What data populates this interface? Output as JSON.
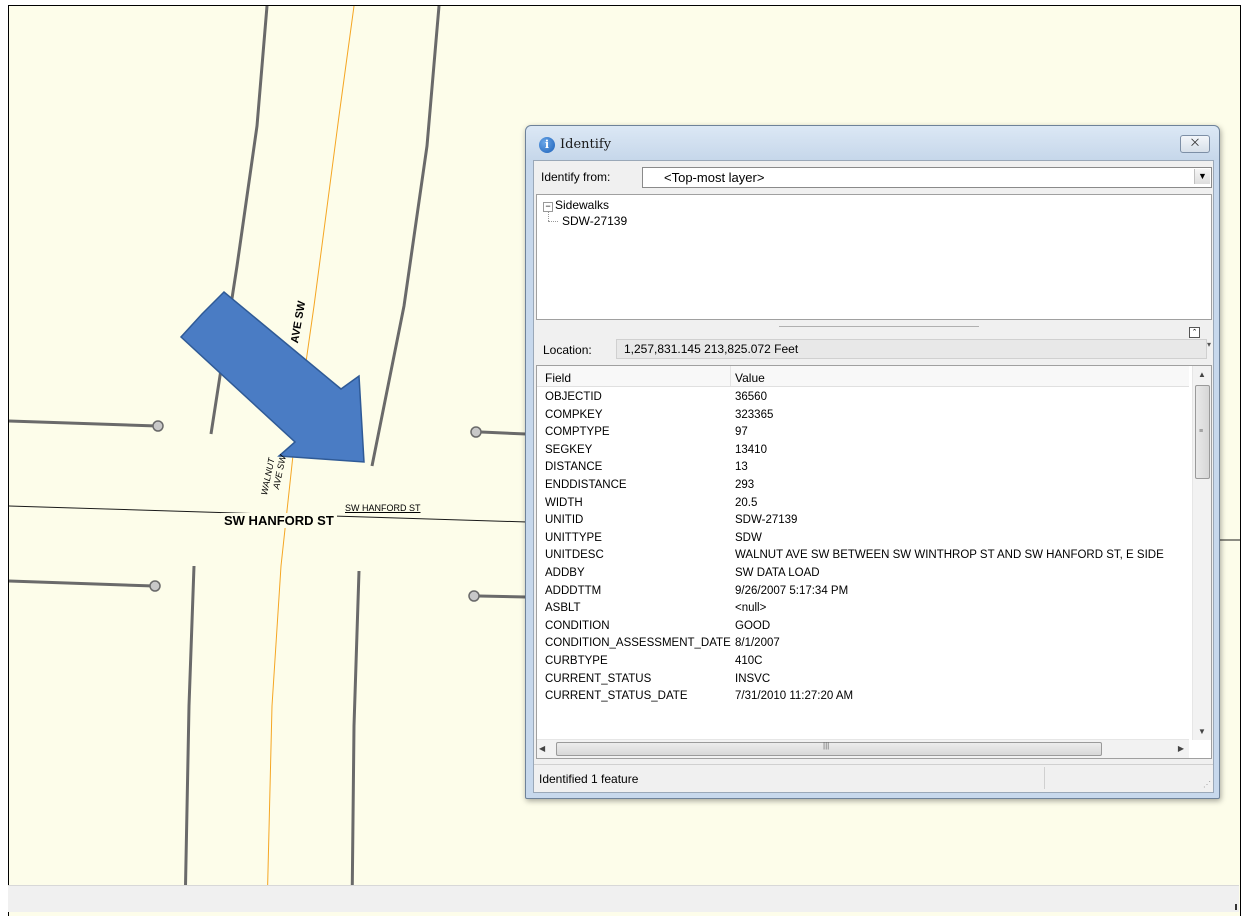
{
  "map": {
    "street_label_main": "SW HANFORD ST",
    "street_label_small": "SW HANFORD ST",
    "avenue_label_bold": "AVE SW",
    "avenue_label_small_line1": "WALNUT",
    "avenue_label_small_line2": "AVE SW",
    "arrow_color": "#4472c4",
    "centerline_color": "#f5a623"
  },
  "identify": {
    "title": "Identify",
    "close_glyph": "⨉",
    "info_glyph": "i",
    "identify_from_label": "Identify from:",
    "identify_from_value": "<Top-most layer>",
    "tree": {
      "toggle_glyph": "−",
      "layer": "Sidewalks",
      "feature": "SDW-27139"
    },
    "location_label": "Location:",
    "location_value": "1,257,831.145  213,825.072 Feet",
    "columns": {
      "field": "Field",
      "value": "Value"
    },
    "rows": [
      {
        "field": "OBJECTID",
        "value": "36560"
      },
      {
        "field": "COMPKEY",
        "value": "323365"
      },
      {
        "field": "COMPTYPE",
        "value": "97"
      },
      {
        "field": "SEGKEY",
        "value": "13410"
      },
      {
        "field": "DISTANCE",
        "value": "13"
      },
      {
        "field": "ENDDISTANCE",
        "value": "293"
      },
      {
        "field": "WIDTH",
        "value": "20.5"
      },
      {
        "field": "UNITID",
        "value": "SDW-27139"
      },
      {
        "field": "UNITTYPE",
        "value": "SDW"
      },
      {
        "field": "UNITDESC",
        "value": "WALNUT AVE SW BETWEEN SW WINTHROP ST AND SW HANFORD ST, E SIDE"
      },
      {
        "field": "ADDBY",
        "value": "SW DATA LOAD"
      },
      {
        "field": "ADDDTTM",
        "value": "9/26/2007 5:17:34 PM"
      },
      {
        "field": "ASBLT",
        "value": "<null>"
      },
      {
        "field": "CONDITION",
        "value": "GOOD"
      },
      {
        "field": "CONDITION_ASSESSMENT_DATE",
        "value": "8/1/2007"
      },
      {
        "field": "CURBTYPE",
        "value": "410C"
      },
      {
        "field": "CURRENT_STATUS",
        "value": "INSVC"
      },
      {
        "field": "CURRENT_STATUS_DATE",
        "value": "7/31/2010 11:27:20 AM"
      }
    ],
    "status_text": "Identified 1 feature"
  }
}
